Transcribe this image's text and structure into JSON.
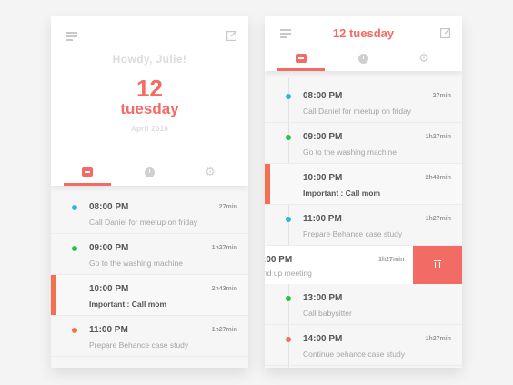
{
  "left": {
    "greeting": "Howdy, Julie!",
    "day": "12",
    "weekday": "tuesday",
    "month": "April 2016",
    "icons": {
      "menu": "menu-icon",
      "edit": "edit-icon",
      "tabs": [
        "calendar-icon",
        "clock-icon",
        "gear-icon"
      ]
    },
    "items": [
      {
        "time": "08:00 PM",
        "duration": "27min",
        "desc": "Call Daniel for meetup on friday",
        "dot": "#2eb8d6",
        "strong": false,
        "active": false
      },
      {
        "time": "09:00 PM",
        "duration": "1h27min",
        "desc": "Go to the washing machine",
        "dot": "#27c24c",
        "strong": false,
        "active": false
      },
      {
        "time": "10:00 PM",
        "duration": "2h43min",
        "desc": "Important : Call mom",
        "dot": "",
        "strong": true,
        "active": true
      },
      {
        "time": "11:00 PM",
        "duration": "1h27min",
        "desc": "Prepare Behance case study",
        "dot": "#f2704f",
        "strong": false,
        "active": false
      }
    ]
  },
  "right": {
    "title": "12 tuesday",
    "icons": {
      "menu": "menu-icon",
      "edit": "edit-icon",
      "tabs": [
        "calendar-icon",
        "clock-icon",
        "gear-icon"
      ]
    },
    "items": [
      {
        "time": "08:00 PM",
        "duration": "27min",
        "desc": "Call Daniel for meetup on friday",
        "dot": "#2eb8d6",
        "strong": false,
        "active": false
      },
      {
        "time": "09:00 PM",
        "duration": "1h27min",
        "desc": "Go to the washing machine",
        "dot": "#27c24c",
        "strong": false,
        "active": false
      },
      {
        "time": "10:00 PM",
        "duration": "2h43min",
        "desc": "Important : Call mom",
        "dot": "",
        "strong": true,
        "active": true
      },
      {
        "time": "11:00 PM",
        "duration": "1h27min",
        "desc": "Prepare Behance case study",
        "dot": "#2eb8d6",
        "strong": false,
        "active": false
      }
    ],
    "swipe_item": {
      "time": ":00 PM",
      "duration": "1h27min",
      "desc": "nd up meeting",
      "delete_icon": "trash-icon"
    },
    "items_after": [
      {
        "time": "13:00 PM",
        "duration": "",
        "desc": "Call babysitter",
        "dot": "#27c24c",
        "strong": false,
        "active": false
      },
      {
        "time": "14:00 PM",
        "duration": "1h27min",
        "desc": "Continue behance case study",
        "dot": "#f2704f",
        "strong": false,
        "active": false
      }
    ]
  },
  "colors": {
    "accent": "#f26b64",
    "important_bar": "#f2704f"
  }
}
